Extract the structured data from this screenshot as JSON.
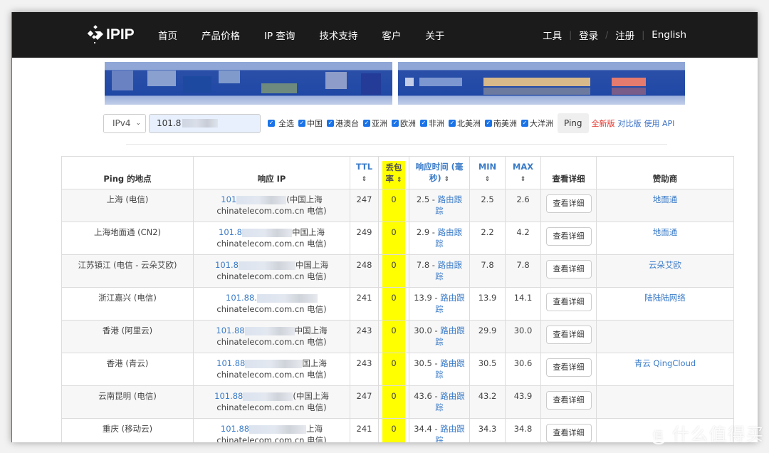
{
  "navbar": {
    "logo_text": "IPIP",
    "left_items": [
      "首页",
      "产品价格",
      "IP 查询",
      "技术支持",
      "客户",
      "关于"
    ],
    "right_items": [
      "工具",
      "登录",
      "注册",
      "English"
    ],
    "separators": [
      "|",
      "/",
      "|"
    ]
  },
  "search": {
    "ip_version": "IPv4",
    "ip_value": "101.8",
    "checkboxes": [
      {
        "label": "全选",
        "checked": true
      },
      {
        "label": "中国",
        "checked": true
      },
      {
        "label": "港澳台",
        "checked": true
      },
      {
        "label": "亚洲",
        "checked": true
      },
      {
        "label": "欧洲",
        "checked": true
      },
      {
        "label": "非洲",
        "checked": true
      },
      {
        "label": "北美洲",
        "checked": true
      },
      {
        "label": "南美洲",
        "checked": true
      },
      {
        "label": "大洋洲",
        "checked": true
      }
    ],
    "ping_button": "Ping",
    "link_new_version": "全新版",
    "link_compare": "对比版",
    "link_api": "使用 API"
  },
  "colors": {
    "navbar_bg": "#1b1b1b",
    "highlight": "#ffff00",
    "link": "#3a7bc8",
    "accent_red": "#e4322b"
  },
  "table": {
    "headers": {
      "location": "Ping 的地点",
      "response_ip": "响应 IP",
      "ttl": "TTL",
      "loss_line1": "丢包",
      "loss_line2": "率",
      "resp_time_line1": "响应时间 (毫",
      "resp_time_line2": "秒)",
      "min": "MIN",
      "max": "MAX",
      "details": "查看详细",
      "sponsor": "赞助商",
      "sort_icon": "⇕"
    },
    "rows": [
      {
        "location": "上海 (电信)",
        "ip_prefix": "101",
        "ip_suffix": "(中国上海",
        "ip_line2": "chinatelecom.com.cn 电信)",
        "ttl": "247",
        "loss": "0",
        "resp": "2.5",
        "route_a": "路由跟",
        "route_b": "踪",
        "min": "2.5",
        "max": "2.6",
        "btn": "查看详细",
        "sponsor": "地面通"
      },
      {
        "location": "上海地面通 (CN2)",
        "ip_prefix": "101.8",
        "ip_suffix": "中国上海",
        "ip_line2": "chinatelecom.com.cn 电信)",
        "ttl": "249",
        "loss": "0",
        "resp": "2.9",
        "route_a": "路由跟",
        "route_b": "踪",
        "min": "2.2",
        "max": "4.2",
        "btn": "查看详细",
        "sponsor": "地面通"
      },
      {
        "location": "江苏镇江 (电信 - 云朵艾欧)",
        "ip_prefix": "101.8",
        "ip_suffix": "中国上海",
        "ip_line2": "chinatelecom.com.cn 电信)",
        "ttl": "248",
        "loss": "0",
        "resp": "7.8",
        "route_a": "路由跟",
        "route_b": "踪",
        "min": "7.8",
        "max": "7.8",
        "btn": "查看详细",
        "sponsor": "云朵艾欧"
      },
      {
        "location": "浙江嘉兴 (电信)",
        "ip_prefix": "101.88.",
        "ip_suffix": "",
        "ip_line2": "chinatelecom.com.cn 电信)",
        "ttl": "241",
        "loss": "0",
        "resp": "13.9",
        "route_a": "路由跟",
        "route_b": "踪",
        "min": "13.9",
        "max": "14.1",
        "btn": "查看详细",
        "sponsor": "陆陆陆网络"
      },
      {
        "location": "香港 (阿里云)",
        "ip_prefix": "101.88",
        "ip_suffix": "中国上海",
        "ip_line2": "chinatelecom.com.cn 电信)",
        "ttl": "243",
        "loss": "0",
        "resp": "30.0",
        "route_a": "路由跟",
        "route_b": "踪",
        "min": "29.9",
        "max": "30.0",
        "btn": "查看详细",
        "sponsor": ""
      },
      {
        "location": "香港 (青云)",
        "ip_prefix": "101.88",
        "ip_suffix": "国上海",
        "ip_line2": "chinatelecom.com.cn 电信)",
        "ttl": "243",
        "loss": "0",
        "resp": "30.5",
        "route_a": "路由跟",
        "route_b": "踪",
        "min": "30.5",
        "max": "30.6",
        "btn": "查看详细",
        "sponsor": "青云 QingCloud"
      },
      {
        "location": "云南昆明 (电信)",
        "ip_prefix": "101.88",
        "ip_suffix": "(中国上海",
        "ip_line2": "chinatelecom.com.cn 电信)",
        "ttl": "247",
        "loss": "0",
        "resp": "43.6",
        "route_a": "路由跟",
        "route_b": "踪",
        "min": "43.2",
        "max": "43.9",
        "btn": "查看详细",
        "sponsor": ""
      },
      {
        "location": "重庆 (移动云)",
        "ip_prefix": "101.88",
        "ip_suffix": "上海",
        "ip_line2": "chinatelecom.com.cn 电信)",
        "ttl": "241",
        "loss": "0",
        "resp": "34.4",
        "route_a": "路由跟",
        "route_b": "踪",
        "min": "34.3",
        "max": "34.8",
        "btn": "查看详细",
        "sponsor": ""
      }
    ]
  },
  "watermark": {
    "circle": "值",
    "text": "什么值得买"
  }
}
